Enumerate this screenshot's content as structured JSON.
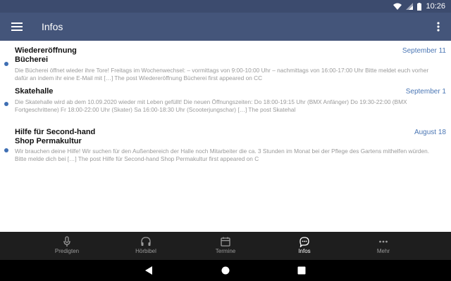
{
  "status_bar": {
    "time": "10:26"
  },
  "app_bar": {
    "title": "Infos"
  },
  "articles": [
    {
      "title_line1": "Wiedereröffnung",
      "title_line2": "Bücherei",
      "date": "September 11",
      "excerpt_line1": "Die Bücherei öffnet wieder ihre Tore! Freitags im Wochenwechsel: – vormittags von 9:00-10:00 Uhr – nachmittags von 16:00-17:00 Uhr Bitte meldet euch vorher",
      "excerpt_line2": "dafür an indem ihr eine E-Mail mit […] The post Wiedereröffnung Bücherei first appeared on CC"
    },
    {
      "title_line1": "Skatehalle",
      "date": "September 1",
      "excerpt_line1": "Die Skatehalle wird ab dem 10.09.2020 wieder mit Leben gefüllt! Die neuen Öffnungszeiten: Do 18:00-19:15 Uhr (BMX Anfänger) Do 19:30-22:00 (BMX",
      "excerpt_line2": "Fortgeschrittene) Fr 18:00-22:00 Uhr (Skater) Sa 16:00-18:30 Uhr (Scooterjungschar) […] The post Skatehal"
    },
    {
      "title_line1": "Hilfe für Second-hand",
      "title_line2": "Shop Permakultur",
      "date": "August 18",
      "excerpt_line1": "Wir brauchen deine Hilfe! Wir suchen für den Außenbereich der Halle noch Mitarbeiter die ca. 3 Stunden im Monat bei der Pflege des Gartens mithelfen würden.",
      "excerpt_line2": "Bitte melde dich bei […] The post Hilfe für Second-hand Shop Permakultur first appeared on C"
    }
  ],
  "bottom_nav": [
    {
      "label": "Predigten",
      "icon": "microphone-icon"
    },
    {
      "label": "Hörbibel",
      "icon": "headphones-icon"
    },
    {
      "label": "Termine",
      "icon": "calendar-icon"
    },
    {
      "label": "Infos",
      "icon": "chat-bubble-icon",
      "active": true
    },
    {
      "label": "Mehr",
      "icon": "more-dots-icon"
    }
  ],
  "colors": {
    "app_bar": "#44557a",
    "status_bar": "#3c4b6e",
    "accent": "#4a76b4",
    "nav_bg": "#1e1e1e"
  }
}
